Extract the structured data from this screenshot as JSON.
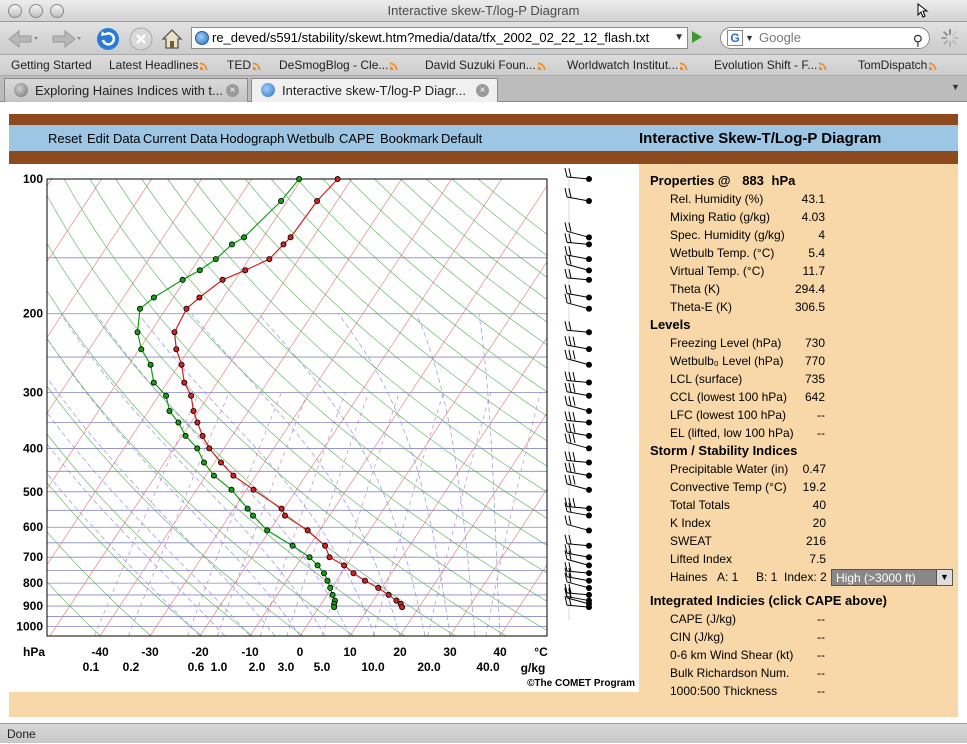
{
  "window": {
    "title": "Interactive skew-T/log-P Diagram"
  },
  "toolbar": {
    "url": "re_deved/s591/stability/skewt.htm?media/data/tfx_2002_02_22_12_flash.txt",
    "search_placeholder": "Google"
  },
  "bookmarks": [
    {
      "label": "Getting Started",
      "rss": false
    },
    {
      "label": "Latest Headlines",
      "rss": true
    },
    {
      "label": "TED",
      "rss": true
    },
    {
      "label": "DeSmogBlog - Cle...",
      "rss": true
    },
    {
      "label": "David Suzuki Foun...",
      "rss": true
    },
    {
      "label": "Worldwatch Institut...",
      "rss": true
    },
    {
      "label": "Evolution Shift - F...",
      "rss": true
    },
    {
      "label": "TomDispatch",
      "rss": true
    }
  ],
  "tabs": [
    {
      "label": "Exploring Haines Indices with t...",
      "active": false
    },
    {
      "label": "Interactive skew-T/log-P Diagr...",
      "active": true
    }
  ],
  "app": {
    "menu": [
      "Reset",
      "Edit Data",
      "Current Data",
      "Hodograph",
      "Wetbulb",
      "CAPE",
      "Bookmark",
      "Default"
    ],
    "title": "Interactive Skew-T/Log-P Diagram",
    "copyright": "©The COMET Program"
  },
  "properties": {
    "header": "Properties @",
    "level": "883",
    "level_unit": "hPa",
    "rows": [
      {
        "label": "Rel. Humidity (%)",
        "value": "43.1"
      },
      {
        "label": "Mixing Ratio (g/kg)",
        "value": "4.03"
      },
      {
        "label": "Spec. Humidity (g/kg)",
        "value": "4"
      },
      {
        "label": "Wetbulb Temp. (°C)",
        "value": "5.4"
      },
      {
        "label": "Virtual Temp. (°C)",
        "value": "11.7"
      },
      {
        "label": "Theta (K)",
        "value": "294.4"
      },
      {
        "label": "Theta-E (K)",
        "value": "306.5"
      }
    ]
  },
  "levels": {
    "header": "Levels",
    "rows": [
      {
        "label": "Freezing Level (hPa)",
        "value": "730"
      },
      {
        "label": "Wetbulb₀ Level (hPa)",
        "value": "770"
      },
      {
        "label": "LCL (surface)",
        "value": "735"
      },
      {
        "label": "CCL (lowest 100 hPa)",
        "value": "642"
      },
      {
        "label": "LFC (lowest 100 hPa)",
        "value": "--"
      },
      {
        "label": "EL (lifted, low 100 hPa)",
        "value": "--"
      }
    ]
  },
  "storm": {
    "header": "Storm / Stability Indices",
    "rows": [
      {
        "label": "Precipitable Water (in)",
        "value": "0.47"
      },
      {
        "label": "Convective Temp (°C)",
        "value": "19.2"
      },
      {
        "label": "Total Totals",
        "value": "40"
      },
      {
        "label": "K Index",
        "value": "20"
      },
      {
        "label": "SWEAT",
        "value": "216"
      },
      {
        "label": "Lifted Index",
        "value": "7.5"
      }
    ],
    "haines_label": "Haines",
    "haines_a": "A: 1",
    "haines_b": "B: 1",
    "haines_index": "Index: 2",
    "haines_select": "High (>3000 ft)"
  },
  "integrated": {
    "header": "Integrated Indicies (click CAPE above)",
    "rows": [
      {
        "label": "CAPE (J/kg)",
        "value": "--"
      },
      {
        "label": "CIN (J/kg)",
        "value": "--"
      },
      {
        "label": "0-6 km Wind Shear (kt)",
        "value": "--"
      },
      {
        "label": "Bulk Richardson Num.",
        "value": "--"
      },
      {
        "label": "1000:500 Thickness",
        "value": "--"
      }
    ]
  },
  "status": {
    "text": "Done"
  },
  "chart_data": {
    "type": "line",
    "title": "",
    "xlabel": "°C",
    "ylabel": "hPa",
    "pressure_ticks": [
      "100",
      "200",
      "300",
      "400",
      "500",
      "600",
      "700",
      "800",
      "900",
      "1000"
    ],
    "temp_ticks": [
      "-40",
      "-30",
      "-20",
      "-10",
      "0",
      "10",
      "20",
      "30",
      "40"
    ],
    "mixing_ticks": [
      "0.1",
      "0.2",
      "0.6",
      "1.0",
      "2.0",
      "3.0",
      "5.0",
      "10.0",
      "20.0",
      "40.0"
    ],
    "mixing_unit": "g/kg",
    "ylim": [
      1050,
      100
    ],
    "xlim": [
      -40,
      48
    ],
    "log_y": true,
    "grid": true,
    "colors": {
      "temperature": "#d42020",
      "dewpoint": "#10a010",
      "isobar": "#6a6ab0",
      "isotherm": "#e08a8a",
      "dry_adiabat": "#4aa84a",
      "moist_adiabat": "#8a8ae0",
      "mixing_ratio": "#b070b0"
    },
    "series": [
      {
        "name": "",
        "color": "#d42020",
        "pressure": [
          100,
          112,
          135,
          140,
          151,
          160,
          168,
          184,
          195,
          220,
          240,
          260,
          285,
          305,
          330,
          350,
          375,
          400,
          430,
          460,
          495,
          545,
          565,
          610,
          660,
          700,
          730,
          760,
          790,
          820,
          850,
          875,
          890,
          905
        ],
        "temp": [
          -52.8,
          -54,
          -54.5,
          -55,
          -55.9,
          -59.2,
          -62.5,
          -64.8,
          -65.9,
          -65.2,
          -62.6,
          -59.5,
          -56.6,
          -53.5,
          -51,
          -48.7,
          -45.9,
          -42.9,
          -38.7,
          -34.5,
          -28.6,
          -20.5,
          -18.9,
          -12.4,
          -6.9,
          -4.5,
          -0.5,
          2.4,
          5.7,
          9.3,
          12.3,
          14.6,
          15.9,
          16.6
        ]
      },
      {
        "name": "",
        "color": "#10a010",
        "pressure": [
          100,
          112,
          135,
          140,
          151,
          160,
          168,
          184,
          195,
          220,
          240,
          260,
          285,
          305,
          330,
          350,
          375,
          400,
          430,
          460,
          495,
          545,
          565,
          610,
          660,
          700,
          730,
          760,
          790,
          820,
          850,
          875,
          890,
          905
        ],
        "temp": [
          -60.5,
          -61.2,
          -63.8,
          -65.3,
          -66.6,
          -68.3,
          -70.5,
          -73.9,
          -75.2,
          -72.6,
          -69.6,
          -65.7,
          -62.7,
          -58.5,
          -55.8,
          -52.5,
          -49.3,
          -45.3,
          -42.1,
          -38.4,
          -33,
          -27.3,
          -25.3,
          -20.5,
          -13.4,
          -8.5,
          -5.8,
          -3.5,
          -1.8,
          -0.3,
          1.1,
          2.3,
          2.6,
          3
        ]
      }
    ],
    "wind_barbs_count": 34
  }
}
